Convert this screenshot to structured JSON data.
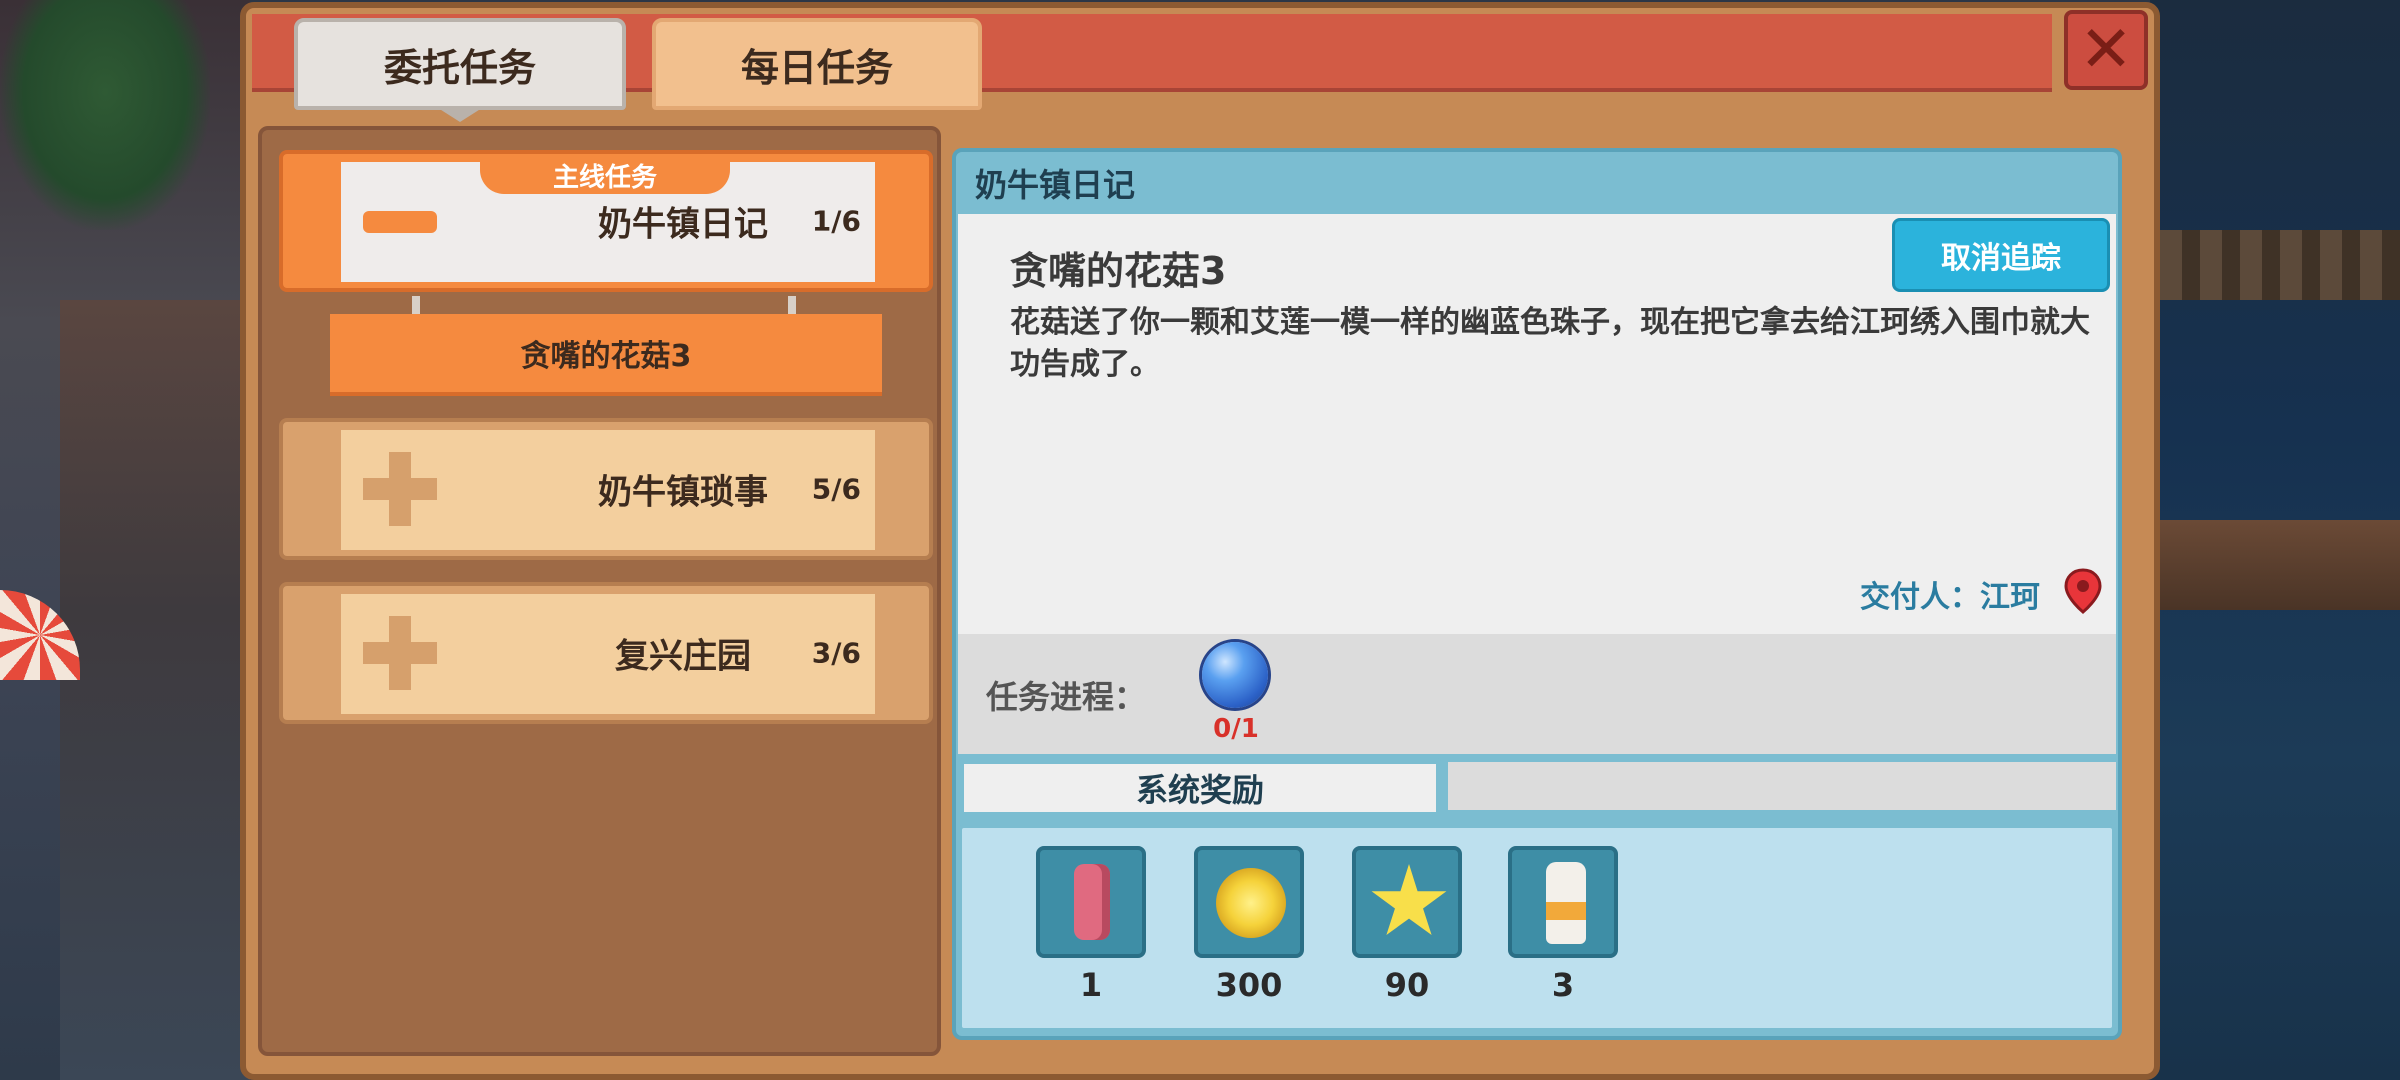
{
  "tabs": {
    "commission": "委托任务",
    "daily": "每日任务"
  },
  "close_icon": "close-x-icon",
  "quest_list": {
    "main_badge": "主线任务",
    "active": {
      "name": "奶牛镇日记",
      "count": "1/6",
      "icon": "minus-icon"
    },
    "active_subquest": "贪嘴的花菇3",
    "others": [
      {
        "name": "奶牛镇琐事",
        "count": "5/6",
        "icon": "plus-icon"
      },
      {
        "name": "复兴庄园",
        "count": "3/6",
        "icon": "plus-icon"
      }
    ]
  },
  "detail": {
    "header": "奶牛镇日记",
    "task_title": "贪嘴的花菇3",
    "description": "花菇送了你一颗和艾莲一模一样的幽蓝色珠子，现在把它拿去给江珂绣入围巾就大功告成了。",
    "untrack_button": "取消追踪",
    "giver": "交付人：江珂",
    "progress_label": "任务进程：",
    "progress_item": {
      "icon": "blue-orb-icon",
      "count": "0/1"
    },
    "reward_tab": "系统奖励",
    "rewards": [
      {
        "icon": "scarf-icon",
        "qty": "1"
      },
      {
        "icon": "gold-coin-icon",
        "qty": "300"
      },
      {
        "icon": "star-icon",
        "qty": "90"
      },
      {
        "icon": "milk-bottle-icon",
        "qty": "3"
      }
    ]
  },
  "colors": {
    "accent_orange": "#f58a3f",
    "header_red": "#d25b45",
    "panel_blue": "#7bbdd1",
    "button_blue": "#2bb3dc",
    "progress_red": "#d8312a"
  }
}
